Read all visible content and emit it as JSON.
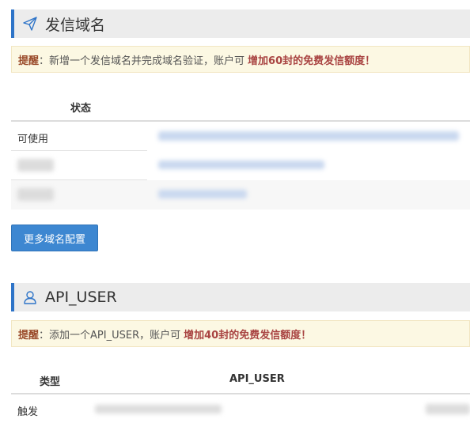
{
  "domain_section": {
    "title": "发信域名",
    "notice": {
      "label": "提醒",
      "colon": "：",
      "text": "新增一个发信域名并完成域名验证，账户可",
      "highlight": "增加60封的免费发信额度！"
    },
    "table": {
      "col_status": "状态",
      "rows": [
        {
          "status": "可使用"
        },
        {
          "status": ""
        },
        {
          "status": ""
        }
      ]
    },
    "more_button": "更多域名配置"
  },
  "api_section": {
    "title": "API_USER",
    "notice": {
      "label": "提醒",
      "colon": "：",
      "text": "添加一个API_USER，账户可",
      "highlight": "增加40封的免费发信额度！"
    },
    "table": {
      "col_type": "类型",
      "col_api_user": "API_USER",
      "rows": [
        {
          "type": "触发"
        }
      ]
    }
  },
  "colors": {
    "accent": "#2e74c8",
    "button": "#3d87d1",
    "notice_bg": "#fcf8e3",
    "highlight": "#a94442"
  },
  "icons": {
    "domain": "paper-plane-icon",
    "api_user": "user-icon"
  }
}
